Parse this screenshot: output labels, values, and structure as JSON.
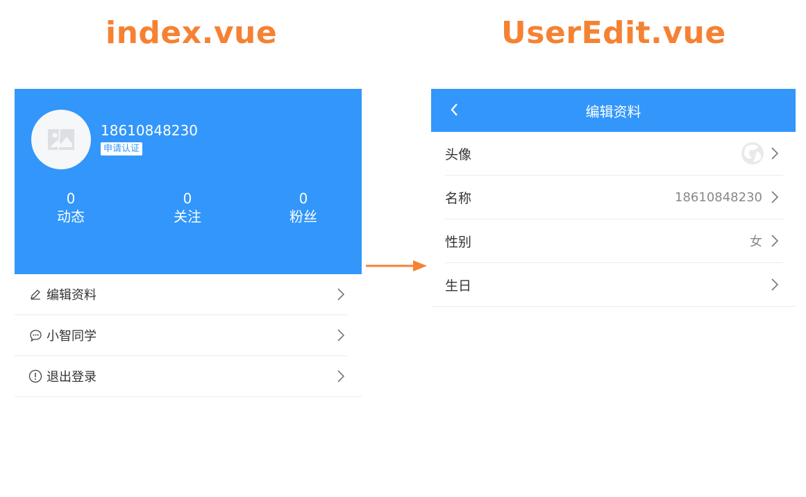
{
  "titles": {
    "left": "index.vue",
    "right": "UserEdit.vue"
  },
  "profile": {
    "username": "18610848230",
    "cert_label": "申请认证",
    "stats": [
      {
        "num": "0",
        "label": "动态"
      },
      {
        "num": "0",
        "label": "关注"
      },
      {
        "num": "0",
        "label": "粉丝"
      }
    ]
  },
  "menu": [
    {
      "label": "编辑资料",
      "icon": "edit-icon"
    },
    {
      "label": "小智同学",
      "icon": "chat-icon"
    },
    {
      "label": "退出登录",
      "icon": "alert-circle-icon"
    }
  ],
  "edit": {
    "nav_title": "编辑资料",
    "rows": [
      {
        "label": "头像",
        "value": ""
      },
      {
        "label": "名称",
        "value": "18610848230"
      },
      {
        "label": "性别",
        "value": "女"
      },
      {
        "label": "生日",
        "value": ""
      }
    ]
  },
  "colors": {
    "accent": "#3296fa",
    "title_orange": "#f58233",
    "arrow": "#f58233"
  }
}
